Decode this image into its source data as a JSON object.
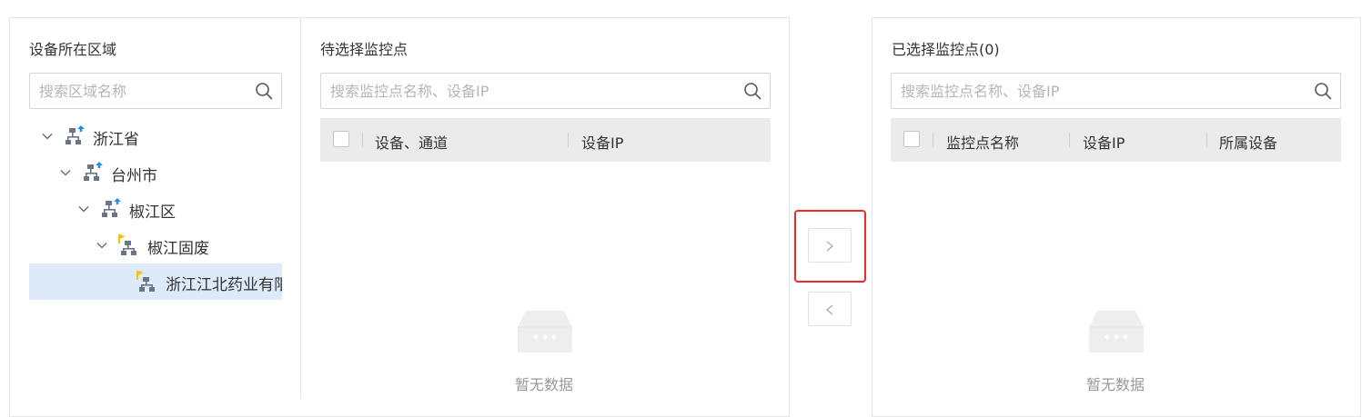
{
  "region_panel": {
    "title": "设备所在区域",
    "search_placeholder": "搜索区域名称",
    "tree": [
      {
        "label": "浙江省",
        "icon": "region-icon",
        "expanded": true
      },
      {
        "label": "台州市",
        "icon": "region-icon",
        "expanded": true
      },
      {
        "label": "椒江区",
        "icon": "region-icon",
        "expanded": true
      },
      {
        "label": "椒江固废",
        "icon": "site-flag-icon",
        "expanded": true
      },
      {
        "label": "浙江江北药业有限公司",
        "icon": "site-flag-icon",
        "selected": true
      }
    ]
  },
  "candidate_panel": {
    "title": "待选择监控点",
    "search_placeholder": "搜索监控点名称、设备IP",
    "columns": [
      "设备、通道",
      "设备IP"
    ],
    "empty_text": "暂无数据"
  },
  "transfer": {
    "add_icon": "chevron-right-icon",
    "remove_icon": "chevron-left-icon"
  },
  "selected_panel": {
    "title": "已选择监控点(0)",
    "search_placeholder": "搜索监控点名称、设备IP",
    "columns": [
      "监控点名称",
      "设备IP",
      "所属设备"
    ],
    "empty_text": "暂无数据"
  },
  "colors": {
    "accent_highlight": "#f02828",
    "selected_row": "#dceaf9",
    "header_bg": "#ebebeb",
    "region_icon_accent": "#1e8fe1",
    "site_flag": "#f5c400"
  }
}
